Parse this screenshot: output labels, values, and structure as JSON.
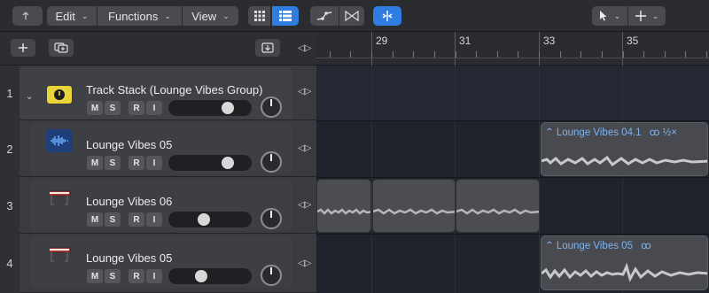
{
  "toolbar": {
    "edit_label": "Edit",
    "functions_label": "Functions",
    "view_label": "View"
  },
  "ruler": {
    "bars": [
      "29",
      "31",
      "33",
      "35"
    ]
  },
  "tracks": [
    {
      "number": "1",
      "name": "Track Stack (Lounge Vibes Group)",
      "buttons": [
        "M",
        "S",
        "R",
        "I"
      ]
    },
    {
      "number": "2",
      "name": "Lounge Vibes 05",
      "buttons": [
        "M",
        "S",
        "R",
        "I"
      ]
    },
    {
      "number": "3",
      "name": "Lounge Vibes 06",
      "buttons": [
        "M",
        "S",
        "R",
        "I"
      ]
    },
    {
      "number": "4",
      "name": "Lounge Vibes 05",
      "buttons": [
        "M",
        "S",
        "R",
        "I"
      ]
    }
  ],
  "regions": [
    {
      "title": "Lounge Vibes 04.1",
      "badges": "ꝏ  ½×"
    },
    {
      "title": "Lounge Vibes 05",
      "badges": "ꝏ"
    }
  ],
  "colors": {
    "accent": "#2f7de0",
    "region_title": "#7fb2f0",
    "stack_icon": "#e9d43a"
  }
}
